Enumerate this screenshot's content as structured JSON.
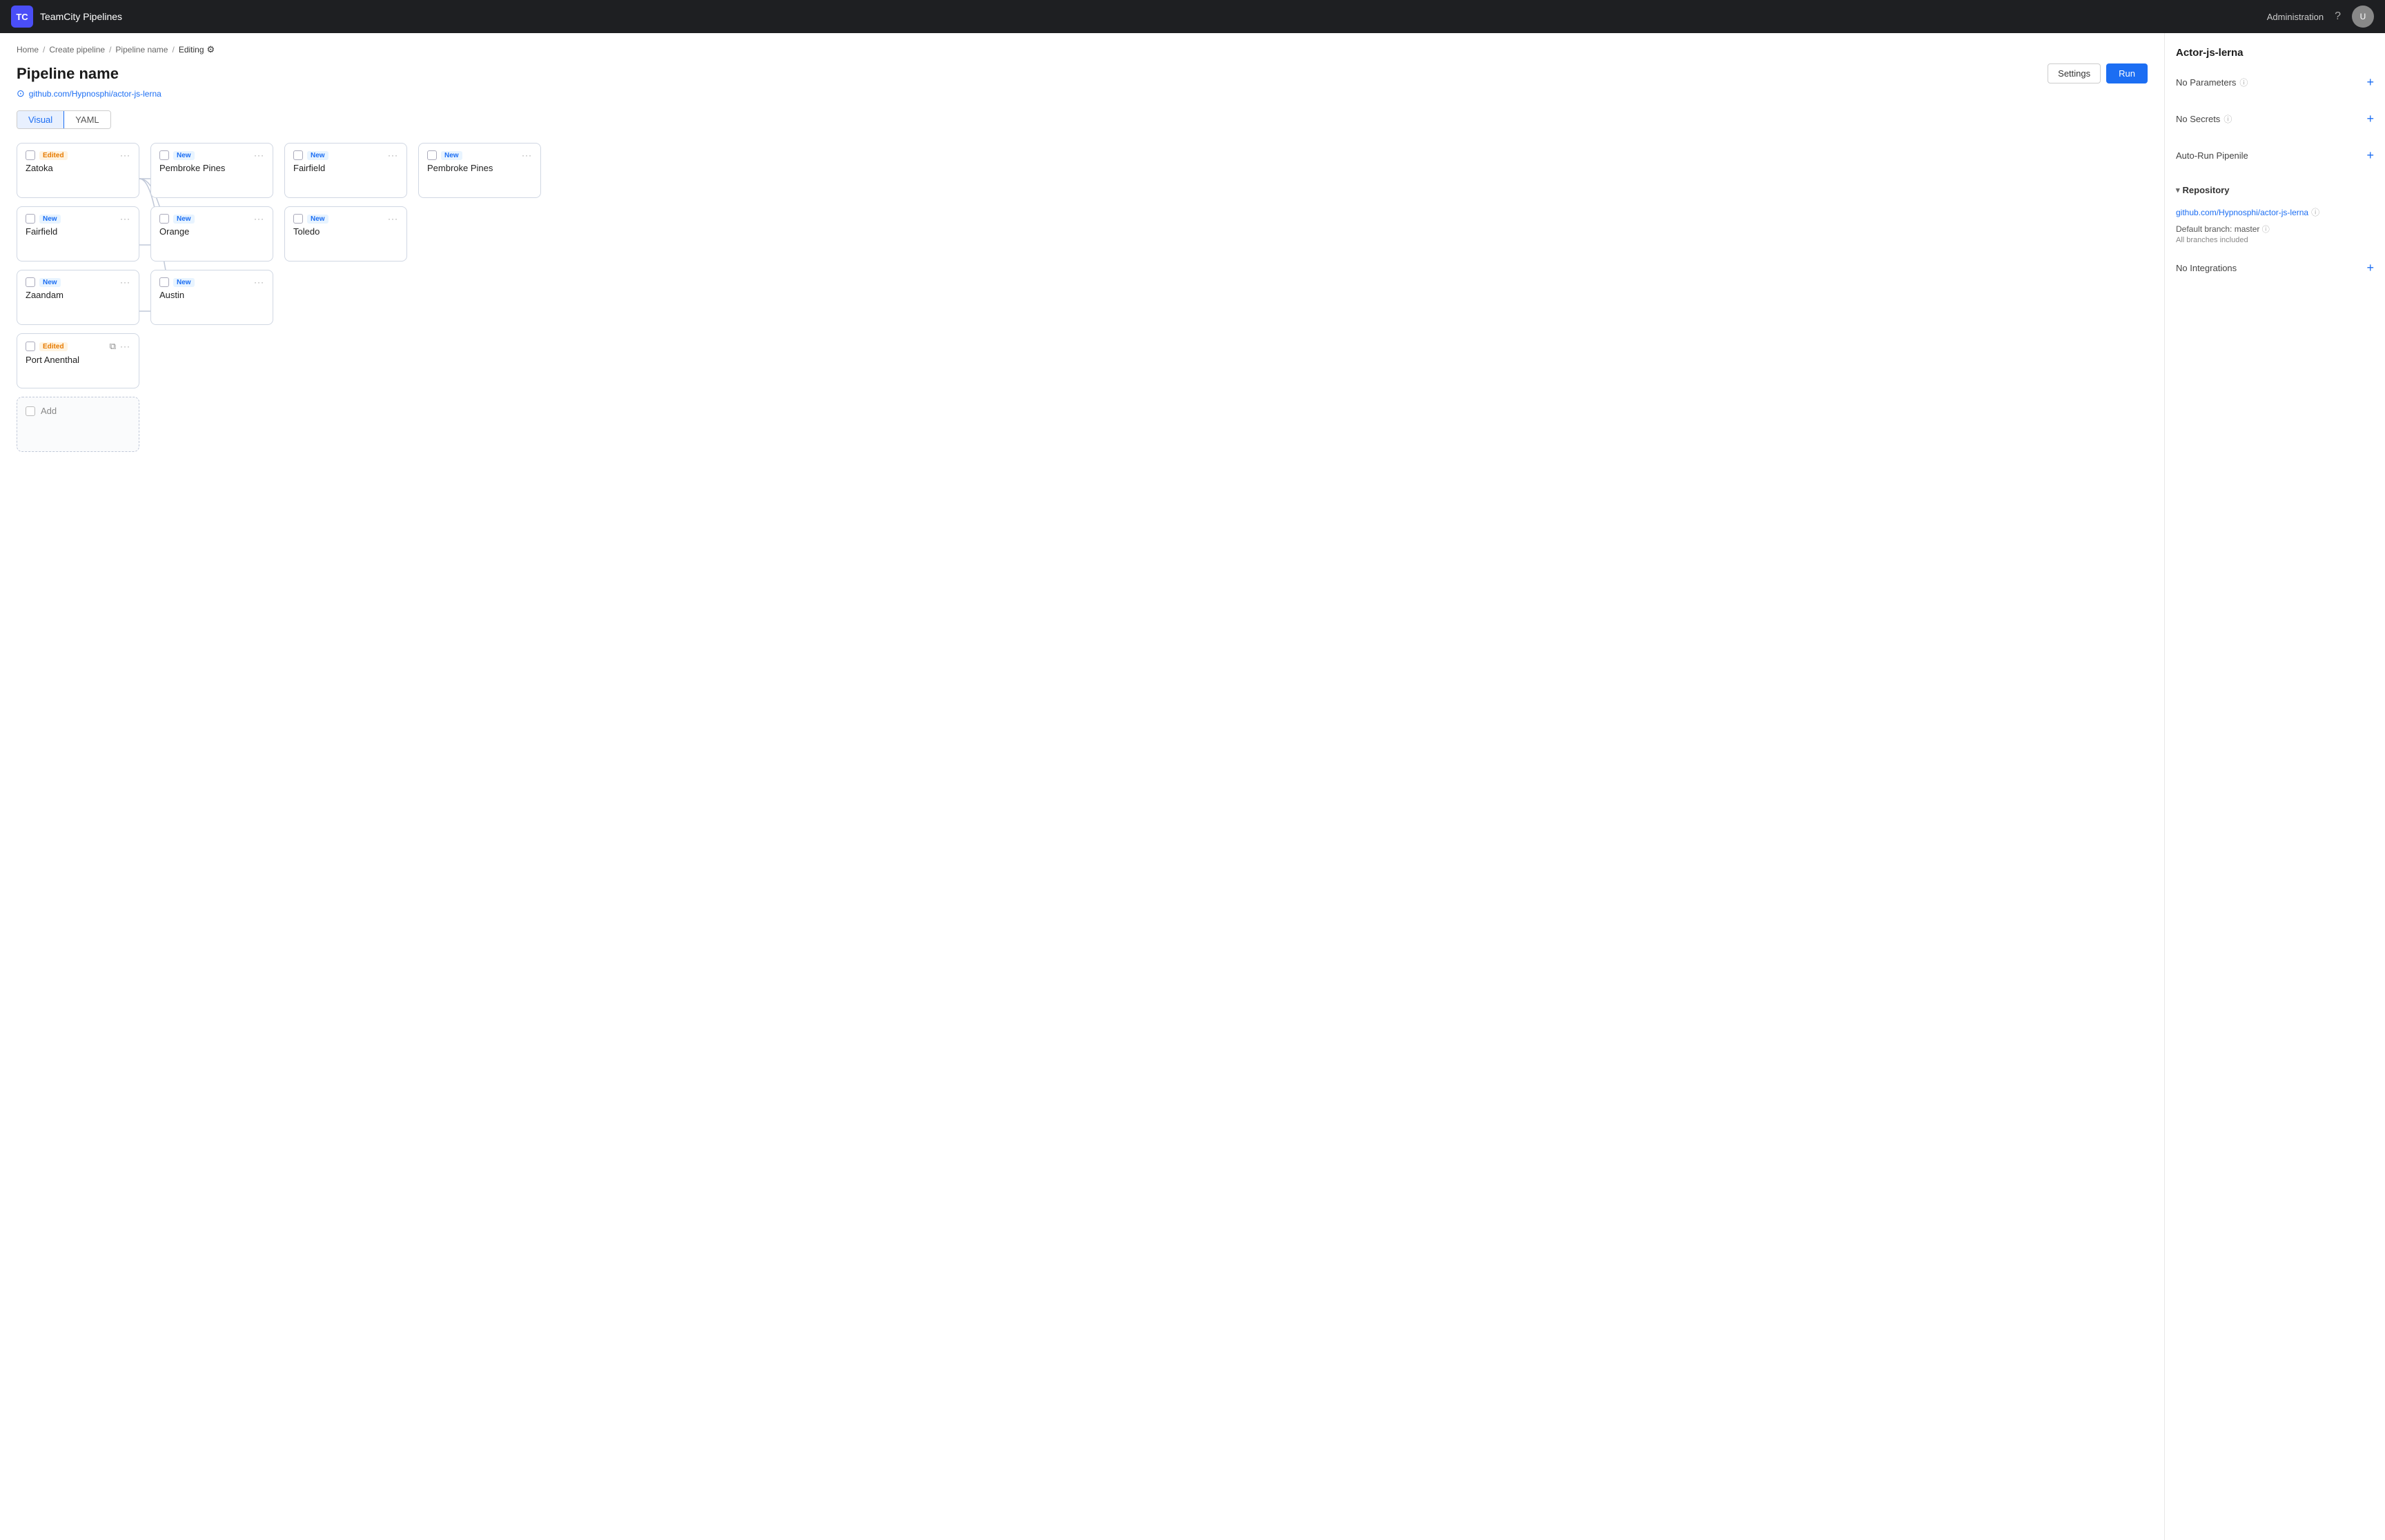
{
  "topnav": {
    "logo": "TC",
    "title": "TeamCity Pipelines",
    "admin_label": "Administration",
    "help_icon": "?",
    "avatar_initials": "U"
  },
  "breadcrumb": {
    "home": "Home",
    "create_pipeline": "Create pipeline",
    "pipeline_name": "Pipeline name",
    "editing": "Editing"
  },
  "page": {
    "title": "Pipeline name",
    "repo_link": "github.com/Hypnosphi/actor-js-lerna",
    "settings_btn": "Settings",
    "run_btn": "Run"
  },
  "view_tabs": [
    {
      "id": "visual",
      "label": "Visual",
      "active": true
    },
    {
      "id": "yaml",
      "label": "YAML",
      "active": false
    }
  ],
  "pipeline": {
    "columns": [
      {
        "id": "col1",
        "cards": [
          {
            "id": "c1",
            "badge": "Edited",
            "badge_type": "edited",
            "name": "Zatoka",
            "has_stack": false
          },
          {
            "id": "c2",
            "badge": "New",
            "badge_type": "new",
            "name": "Fairfield",
            "has_stack": false
          },
          {
            "id": "c3",
            "badge": "New",
            "badge_type": "new",
            "name": "Zaandam",
            "has_stack": false
          },
          {
            "id": "c4",
            "badge": "Edited",
            "badge_type": "edited",
            "name": "Port Anenthal",
            "has_stack": true
          },
          {
            "id": "c5",
            "badge": "",
            "badge_type": "add",
            "name": "Add",
            "is_add": true
          }
        ]
      },
      {
        "id": "col2",
        "cards": [
          {
            "id": "c6",
            "badge": "New",
            "badge_type": "new",
            "name": "Pembroke Pines",
            "has_stack": false
          },
          {
            "id": "c7",
            "badge": "New",
            "badge_type": "new",
            "name": "Orange",
            "has_stack": false
          },
          {
            "id": "c8",
            "badge": "New",
            "badge_type": "new",
            "name": "Austin",
            "has_stack": false
          }
        ]
      },
      {
        "id": "col3",
        "cards": [
          {
            "id": "c9",
            "badge": "New",
            "badge_type": "new",
            "name": "Fairfield",
            "has_stack": false
          },
          {
            "id": "c10",
            "badge": "New",
            "badge_type": "new",
            "name": "Toledo",
            "has_stack": false
          }
        ]
      },
      {
        "id": "col4",
        "cards": [
          {
            "id": "c11",
            "badge": "New",
            "badge_type": "new",
            "name": "Pembroke Pines",
            "has_stack": false
          }
        ]
      }
    ]
  },
  "right_panel": {
    "title": "Actor-js-lerna",
    "sections": [
      {
        "id": "parameters",
        "label": "No Parameters",
        "has_info": true,
        "has_add": true,
        "collapsible": false
      },
      {
        "id": "secrets",
        "label": "No Secrets",
        "has_info": true,
        "has_add": true,
        "collapsible": false
      },
      {
        "id": "autorun",
        "label": "Auto-Run Pipenile",
        "has_info": false,
        "has_add": true,
        "collapsible": false
      },
      {
        "id": "repository",
        "label": "Repository",
        "has_info": false,
        "has_add": false,
        "collapsible": true,
        "expanded": true,
        "repo": "github.com/Hypnosphi/actor-js-lerna",
        "repo_info": true,
        "branch_label": "Default branch: master",
        "branch_info": true,
        "branch_note": "All branches included"
      },
      {
        "id": "integrations",
        "label": "No Integrations",
        "has_info": false,
        "has_add": true,
        "collapsible": false
      }
    ]
  }
}
